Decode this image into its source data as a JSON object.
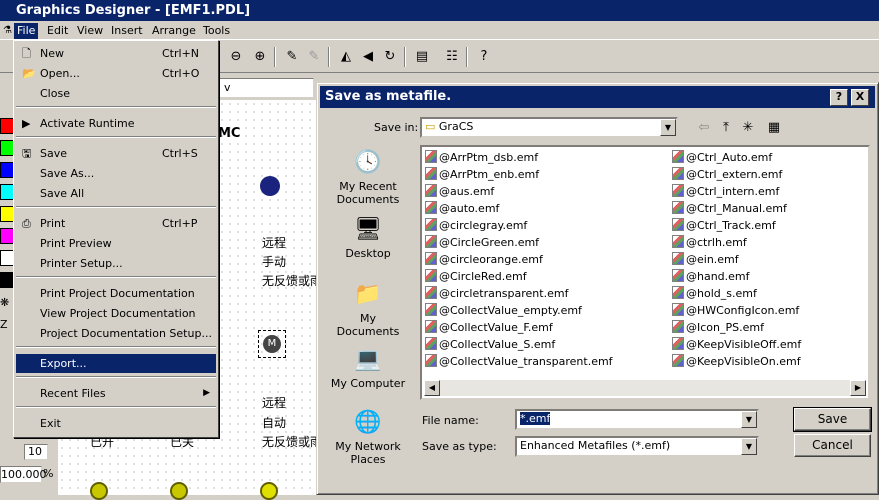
{
  "window": {
    "title": "Graphics Designer - [EMF1.PDL]"
  },
  "menubar": [
    "File",
    "Edit",
    "View",
    "Insert",
    "Arrange",
    "Tools"
  ],
  "left_panel": {
    "zoom_value": "10",
    "zoom_percent": "100.000",
    "percent_sign": "%"
  },
  "canvas": {
    "texts": [
      "远程",
      "手动",
      "无反馈或雨",
      "远程",
      "自动",
      "无反馈或雨",
      "已开",
      "已关"
    ],
    "motor_label": "M",
    "partial_label": "MC",
    "mini_select": "v"
  },
  "file_menu": {
    "items": [
      {
        "label": "New",
        "shortcut": "Ctrl+N"
      },
      {
        "label": "Open...",
        "shortcut": "Ctrl+O"
      },
      {
        "label": "Close",
        "shortcut": ""
      },
      {
        "label": "Activate Runtime",
        "shortcut": ""
      },
      {
        "label": "Save",
        "shortcut": "Ctrl+S"
      },
      {
        "label": "Save As...",
        "shortcut": ""
      },
      {
        "label": "Save All",
        "shortcut": ""
      },
      {
        "label": "Print",
        "shortcut": "Ctrl+P"
      },
      {
        "label": "Print Preview",
        "shortcut": ""
      },
      {
        "label": "Printer Setup...",
        "shortcut": ""
      },
      {
        "label": "Print Project Documentation",
        "shortcut": ""
      },
      {
        "label": "View Project Documentation",
        "shortcut": ""
      },
      {
        "label": "Project Documentation Setup...",
        "shortcut": ""
      },
      {
        "label": "Export...",
        "shortcut": ""
      },
      {
        "label": "Recent Files",
        "shortcut": ""
      },
      {
        "label": "Exit",
        "shortcut": ""
      }
    ],
    "highlighted": "Export..."
  },
  "dialog": {
    "title": "Save as metafile.",
    "save_in_label": "Save in:",
    "save_in_value": "GraCS",
    "places": [
      "My Recent Documents",
      "Desktop",
      "My Documents",
      "My Computer",
      "My Network Places"
    ],
    "files_col1": [
      "@ArrPtm_dsb.emf",
      "@ArrPtm_enb.emf",
      "@aus.emf",
      "@auto.emf",
      "@circlegray.emf",
      "@CircleGreen.emf",
      "@circleorange.emf",
      "@CircleRed.emf",
      "@circletransparent.emf",
      "@CollectValue_empty.emf",
      "@CollectValue_F.emf",
      "@CollectValue_S.emf",
      "@CollectValue_transparent.emf"
    ],
    "files_col2": [
      "@Ctrl_Auto.emf",
      "@Ctrl_extern.emf",
      "@Ctrl_intern.emf",
      "@Ctrl_Manual.emf",
      "@Ctrl_Track.emf",
      "@ctrlh.emf",
      "@ein.emf",
      "@hand.emf",
      "@hold_s.emf",
      "@HWConfigIcon.emf",
      "@Icon_PS.emf",
      "@KeepVisibleOff.emf",
      "@KeepVisibleOn.emf"
    ],
    "file_name_label": "File name:",
    "file_name_value": "*.emf",
    "save_type_label": "Save as type:",
    "save_type_value": "Enhanced Metafiles (*.emf)",
    "save_button": "Save",
    "cancel_button": "Cancel",
    "help_glyph": "?",
    "close_glyph": "X"
  },
  "colors": {
    "titlebar": "#0a246a",
    "face": "#d4d0c8",
    "highlight": "#0a246a"
  }
}
